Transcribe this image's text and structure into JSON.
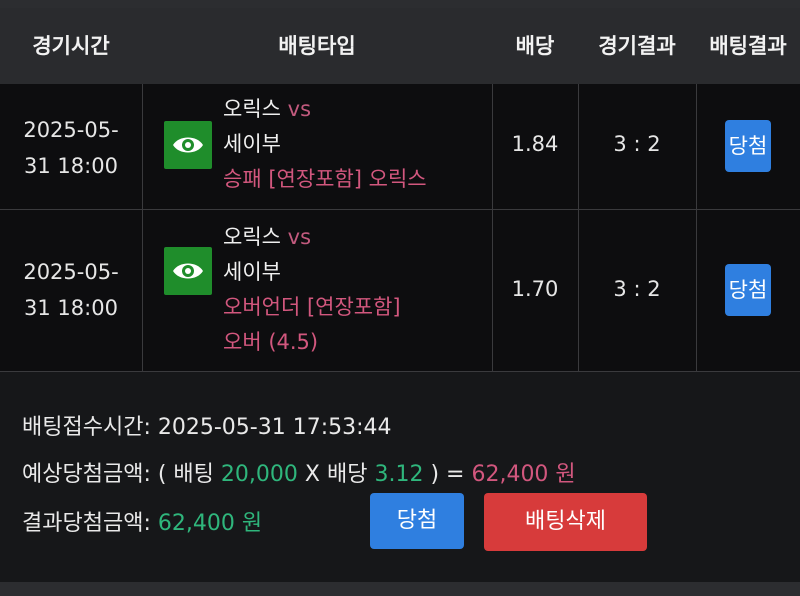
{
  "header": {
    "col_time": "경기시간",
    "col_bet_type": "배팅타입",
    "col_odds": "배당",
    "col_game_result": "경기결과",
    "col_bet_result": "배팅결과"
  },
  "rows": [
    {
      "time_line1": "2025-05-",
      "time_line2": "31 18:00",
      "home_team": "오릭스",
      "vs": "vs",
      "away_team": "세이부",
      "pick_line1": "승패 [연장포함] 오릭스",
      "pick_line2": "",
      "odds": "1.84",
      "score": "3 : 2",
      "result": "당첨"
    },
    {
      "time_line1": "2025-05-",
      "time_line2": "31 18:00",
      "home_team": "오릭스",
      "vs": "vs",
      "away_team": "세이부",
      "pick_line1": "오버언더 [연장포함]",
      "pick_line2": "오버 (4.5)",
      "odds": "1.70",
      "score": "3 : 2",
      "result": "당첨"
    }
  ],
  "summary": {
    "accept_label": "배팅접수시간:",
    "accept_time": "2025-05-31 17:53:44",
    "expected_label": "예상당첨금액:",
    "open_paren": "( 배팅",
    "bet_amount": "20,000",
    "times_odds": "X 배당",
    "total_odds": "3.12",
    "close_equals": ") =",
    "expected_amount": "62,400 원",
    "actual_label": "결과당첨금액:",
    "actual_amount": "62,400 원",
    "win_button": "당첨",
    "delete_button": "배팅삭제"
  },
  "icons": {
    "preview": "eye-icon"
  },
  "colors": {
    "accent_blue": "#2f7fe0",
    "danger_red": "#d73b3b",
    "money_green": "#2fb67c",
    "pick_pink": "#d2577e",
    "eye_green": "#1f8d2b"
  }
}
